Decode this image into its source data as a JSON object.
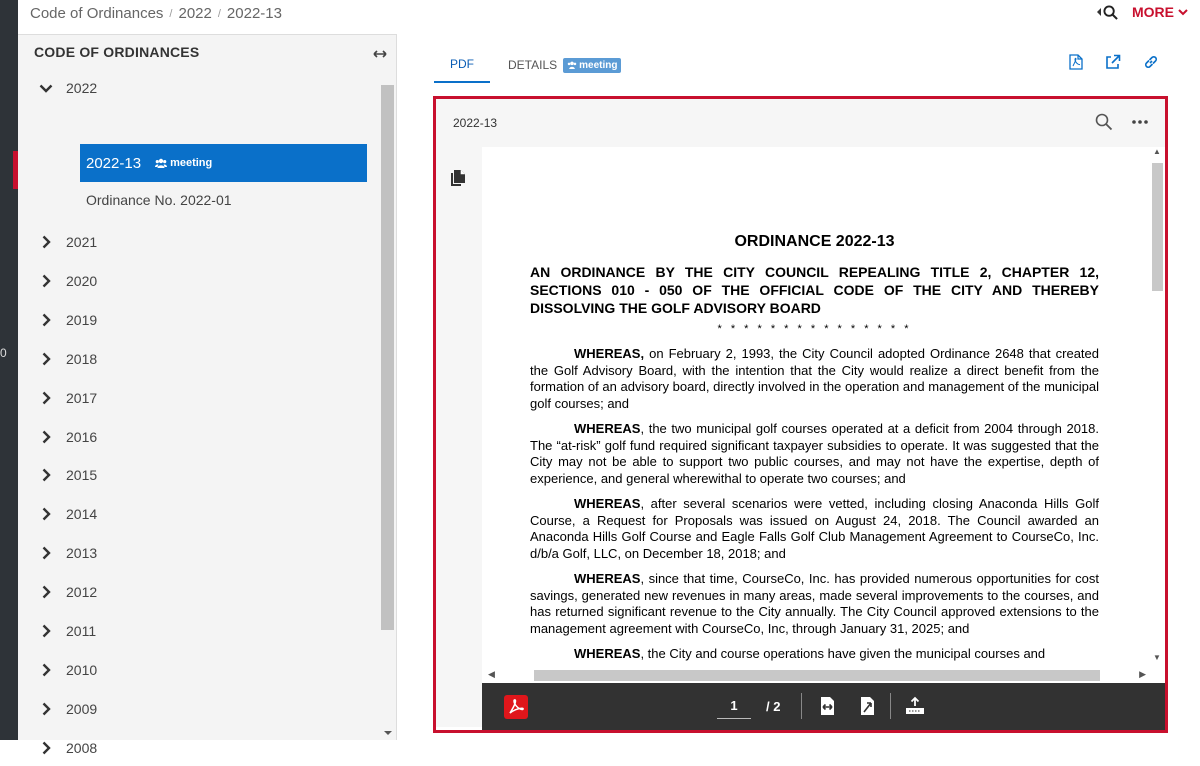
{
  "breadcrumb": {
    "items": [
      "Code of Ordinances",
      "2022",
      "2022-13"
    ],
    "sep": "/"
  },
  "topbar": {
    "more_label": "MORE"
  },
  "sidebar": {
    "title": "CODE OF ORDINANCES",
    "open_year": "2022",
    "active_item": {
      "label": "2022-13",
      "badge": "meeting"
    },
    "child_item": "Ordinance No. 2022-01",
    "years": [
      "2021",
      "2020",
      "2019",
      "2018",
      "2017",
      "2016",
      "2015",
      "2014",
      "2013",
      "2012",
      "2011",
      "2010",
      "2009",
      "2008"
    ]
  },
  "tabs": {
    "pdf": "PDF",
    "details": "DETAILS",
    "details_badge": "meeting"
  },
  "viewer": {
    "file_name": "2022-13",
    "page_current": "1",
    "page_total": "/ 2"
  },
  "document": {
    "heading": "ORDINANCE 2022-13",
    "subheading": "AN ORDINANCE BY THE CITY COUNCIL REPEALING TITLE 2, CHAPTER 12, SECTIONS 010 - 050 OF THE OFFICIAL CODE OF THE CITY AND THEREBY DISSOLVING THE GOLF ADVISORY BOARD",
    "stars": "* * * * * * * * * * * * * * *",
    "paragraphs": [
      {
        "lead": "WHEREAS,",
        "text": " on February 2, 1993, the City Council adopted Ordinance 2648 that created the Golf Advisory Board, with the intention that the City would realize a direct benefit from the formation of an advisory board, directly involved in the operation and management of the municipal golf courses; and"
      },
      {
        "lead": "WHEREAS",
        "text": ", the two municipal golf courses operated at a deficit from 2004 through 2018. The “at-risk” golf fund required significant taxpayer subsidies to operate. It was suggested that the City may not be able to support two public courses, and may not have the expertise, depth of experience, and general wherewithal to operate two courses; and"
      },
      {
        "lead": "WHEREAS",
        "text": ", after several scenarios were vetted, including closing Anaconda Hills Golf Course, a Request for Proposals was issued on August 24, 2018. The Council awarded an Anaconda Hills Golf Course and Eagle Falls Golf Club Management Agreement to CourseCo, Inc. d/b/a Golf, LLC, on December 18, 2018; and"
      },
      {
        "lead": "WHEREAS",
        "text": ", since that time, CourseCo, Inc. has provided numerous opportunities for cost savings, generated new revenues in many areas, made several improvements to the courses, and has returned significant revenue to the City annually. The City Council approved extensions to the management agreement with CourseCo, Inc, through January 31, 2025; and"
      },
      {
        "lead": "WHEREAS",
        "text": ", the City and course operations have given the municipal courses and"
      }
    ]
  },
  "colors": {
    "accent": "#c8102e",
    "active": "#0a70c9",
    "badge": "#5b9bd5"
  }
}
